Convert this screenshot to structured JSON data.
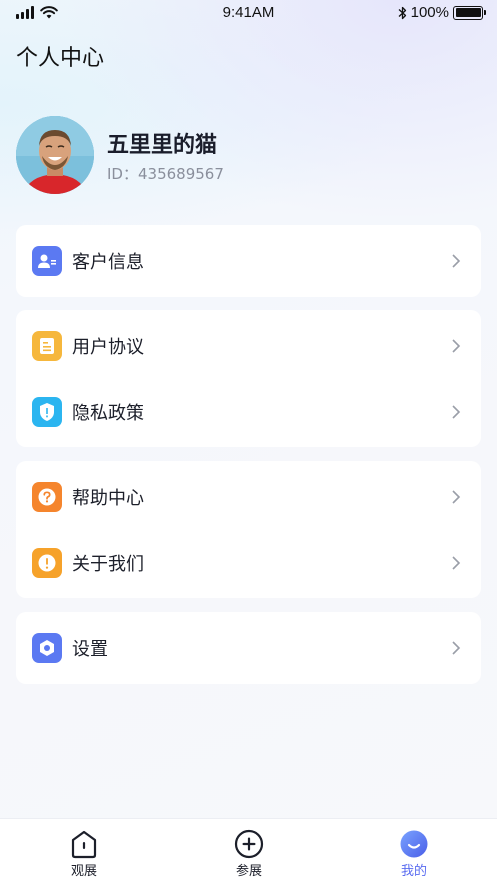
{
  "status_bar": {
    "time": "9:41AM",
    "battery": "100%",
    "icons": [
      "signal-icon",
      "wifi-icon",
      "bluetooth-icon",
      "battery-icon"
    ]
  },
  "header": {
    "title": "个人中心"
  },
  "profile": {
    "nickname": "五里里的猫",
    "id_label": "ID：",
    "id_value": "435689567"
  },
  "menu_groups": [
    [
      {
        "label": "客户信息",
        "icon": "customer-info-icon",
        "color": "#5b79f2"
      }
    ],
    [
      {
        "label": "用户协议",
        "icon": "user-agreement-icon",
        "color": "#f6b73c"
      },
      {
        "label": "隐私政策",
        "icon": "privacy-shield-icon",
        "color": "#2bb5f0"
      }
    ],
    [
      {
        "label": "帮助中心",
        "icon": "help-question-icon",
        "color": "#f5852d"
      },
      {
        "label": "关于我们",
        "icon": "about-info-icon",
        "color": "#f6a22a"
      }
    ],
    [
      {
        "label": "设置",
        "icon": "settings-hex-icon",
        "color": "#5b79f2"
      }
    ]
  ],
  "tab_bar": {
    "tabs": [
      {
        "label": "观展",
        "icon": "home-icon",
        "active": false
      },
      {
        "label": "参展",
        "icon": "plus-circle-icon",
        "active": false
      },
      {
        "label": "我的",
        "icon": "profile-smile-icon",
        "active": true
      }
    ],
    "active_color": "#5a6cf0"
  }
}
